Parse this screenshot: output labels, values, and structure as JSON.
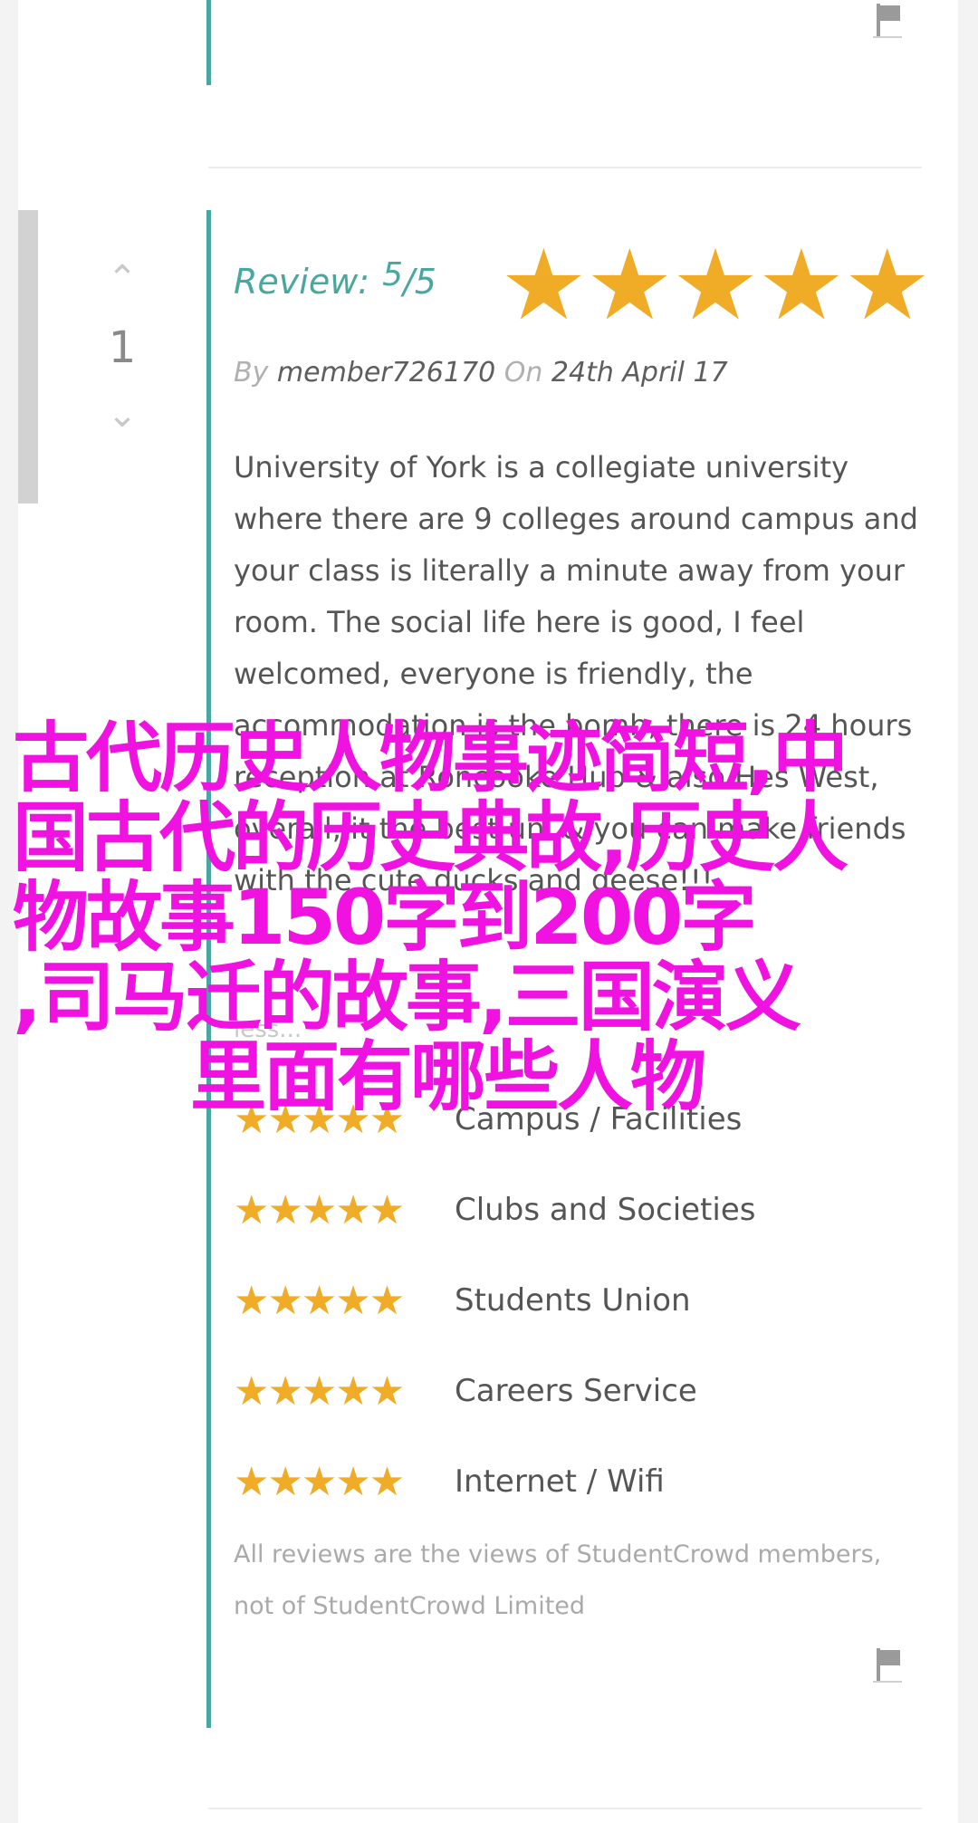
{
  "vote": {
    "up_icon": "chevron-up-icon",
    "count": "1",
    "down_icon": "chevron-down-icon"
  },
  "review": {
    "label": "Review:",
    "score": "5",
    "denominator": "/5",
    "stars": "★★★★★",
    "by_label": "By",
    "author": "member726170",
    "on_label": "On",
    "date": "24th April 17",
    "body": "University of York is a collegiate university where there are 9 colleges around campus and your class is literally a minute away from your room. The social life here is good, I feel welcomed, everyone is friendly, the accommodation is the bomb, there is 24 hours reception at Roncooke Hub & also Hes West, overall, it the best uni & you can make friends with the cute ducks and geese!!!",
    "read_less": "less..."
  },
  "ratings": [
    {
      "label": "Campus / Facilities",
      "stars": "★★★★★"
    },
    {
      "label": "Clubs and Societies",
      "stars": "★★★★★"
    },
    {
      "label": "Students Union",
      "stars": "★★★★★"
    },
    {
      "label": "Careers Service",
      "stars": "★★★★★"
    },
    {
      "label": "Internet / Wifi",
      "stars": "★★★★★"
    }
  ],
  "disclaimer": "All reviews are the views of StudentCrowd members, not of StudentCrowd Limited",
  "overlay_lines": [
    "古代历史人物事迹简短,中",
    "国古代的历史典故,历史人",
    "物故事150字到200字",
    ",司马迁的故事,三国演义",
    "里面有哪些人物"
  ],
  "colors": {
    "accent": "#4aa6a0",
    "star": "#f0ab27",
    "overlay": "#f012e0"
  }
}
